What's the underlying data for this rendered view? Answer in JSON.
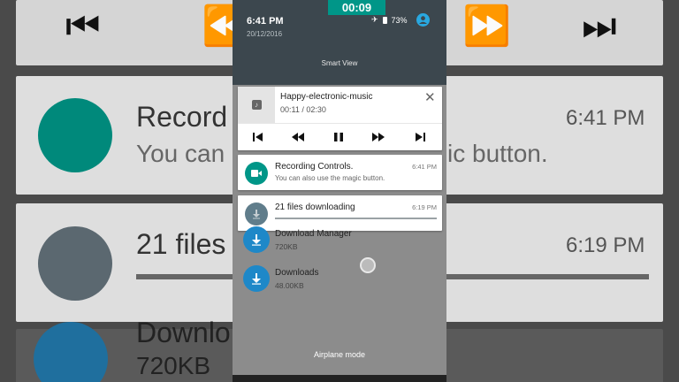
{
  "status_bar": {
    "recording_timer": "00:09",
    "time": "6:41 PM",
    "date": "20/12/2016",
    "battery": "73%",
    "icons": [
      "airplane-icon",
      "battery-icon",
      "account-icon"
    ]
  },
  "quick_settings": {
    "smart_view_label": "Smart View"
  },
  "media_player": {
    "track": "Happy-electronic-music",
    "progress": "00:11 / 02:30",
    "controls": [
      "skip-previous-icon",
      "rewind-icon",
      "pause-icon",
      "fast-forward-icon",
      "skip-next-icon"
    ]
  },
  "notifications": [
    {
      "title": "Recording Controls.",
      "text": "You can also use the magic button.",
      "time": "6:41 PM",
      "icon": "videocam-icon",
      "color": "#009688"
    },
    {
      "title": "21 files downloading",
      "time": "6:19 PM",
      "icon": "download-icon",
      "color": "#607d8b"
    }
  ],
  "background_list": [
    {
      "title": "Download Manager",
      "size": "720KB",
      "icon": "download-icon"
    },
    {
      "title": "Downloads",
      "size": "48.00KB",
      "icon": "download-icon"
    }
  ],
  "footer": {
    "mode": "Airplane mode"
  },
  "background_zoom": {
    "rec_title": "Record",
    "rec_sub_left": "You can",
    "rec_sub_right": "ic button.",
    "rec_time": "6:41 PM",
    "dl_title": "21 files",
    "dl_time": "6:19 PM",
    "dm_title": "Downlo",
    "dm_size": "720KB"
  }
}
